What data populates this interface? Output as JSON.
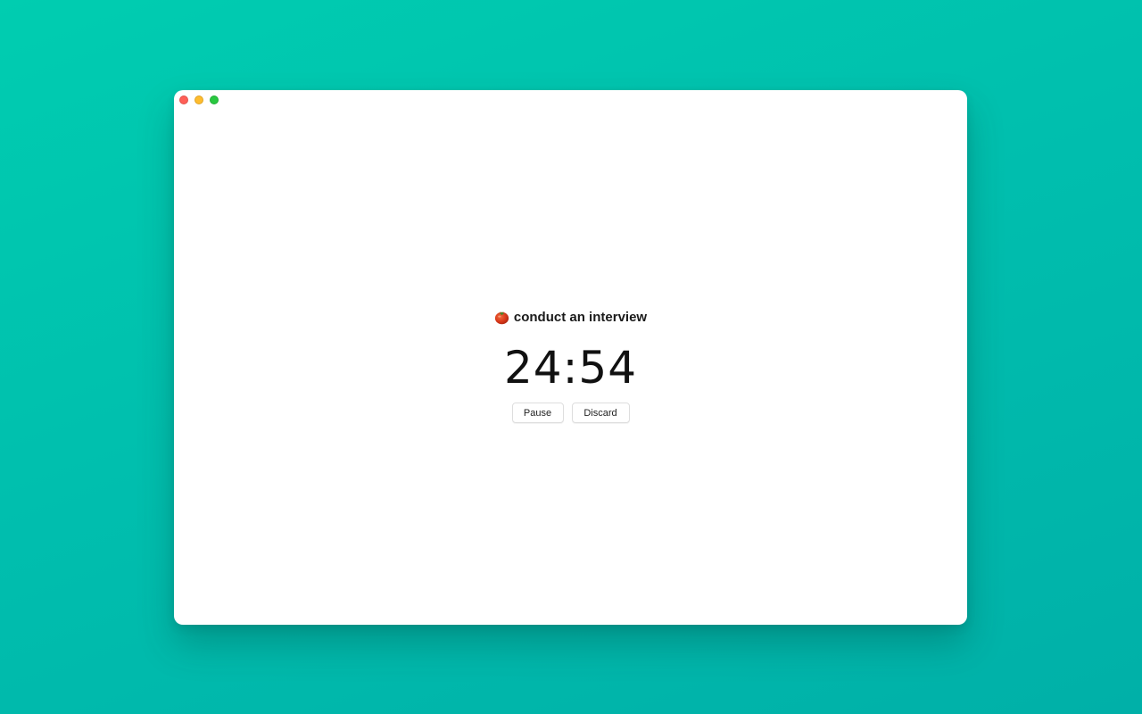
{
  "window": {
    "traffic_lights": [
      {
        "name": "close",
        "color": "#ff5f57"
      },
      {
        "name": "minimize",
        "color": "#febc2e"
      },
      {
        "name": "zoom",
        "color": "#28c840"
      }
    ]
  },
  "task": {
    "icon": "tomato-icon",
    "label": "conduct an interview"
  },
  "timer": {
    "display": "24:54"
  },
  "controls": {
    "pause_label": "Pause",
    "discard_label": "Discard"
  },
  "colors": {
    "background_gradient_start": "#00cdb0",
    "background_gradient_end": "#00b0a8",
    "window_background": "#ffffff",
    "text": "#1a1a1a"
  }
}
